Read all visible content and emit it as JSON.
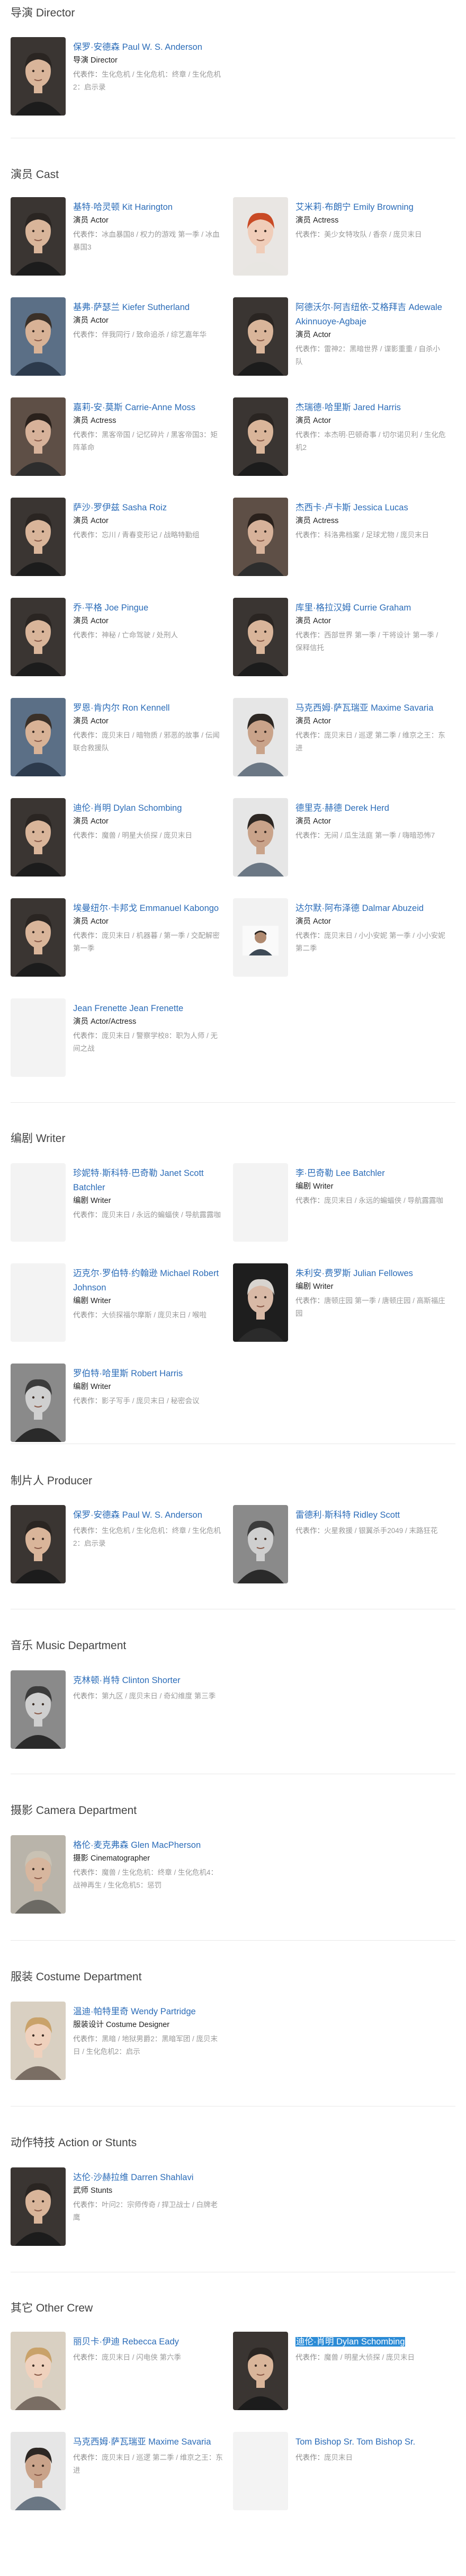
{
  "sections": {
    "director": {
      "title": "导演 Director",
      "people": [
        {
          "name": "保罗·安德森 Paul W. S. Anderson",
          "role": "导演 Director",
          "works_label": "代表作：",
          "works": "生化危机 / 生化危机：终章 / 生化危机2：启示录",
          "photo": "man-dark"
        }
      ]
    },
    "cast": {
      "title": "演员 Cast",
      "people": [
        {
          "name": "基特·哈灵顿 Kit Harington",
          "role": "演员 Actor",
          "works_label": "代表作：",
          "works": "冰血暴国8 / 权力的游戏 第一季 / 冰血暴国3",
          "photo": "man-dark"
        },
        {
          "name": "艾米莉·布朗宁 Emily Browning",
          "role": "演员 Actress",
          "works_label": "代表作：",
          "works": "美少女特攻队 / 香奈 / 庞贝末日",
          "photo": "woman-red"
        },
        {
          "name": "基弗·萨瑟兰 Kiefer Sutherland",
          "role": "演员 Actor",
          "works_label": "代表作：",
          "works": "伴我同行 / 致命追杀 / 综艺嘉年华",
          "photo": "man-blue"
        },
        {
          "name": "阿德沃尔·阿吉纽依-艾格拜吉 Adewale Akinnuoye-Agbaje",
          "role": "演员 Actor",
          "works_label": "代表作：",
          "works": "雷神2：黑暗世界 / 谍影重重 / 自杀小队",
          "photo": "man-dark"
        },
        {
          "name": "嘉莉-安·莫斯 Carrie-Anne Moss",
          "role": "演员 Actress",
          "works_label": "代表作：",
          "works": "黑客帝国 / 记忆碎片 / 黑客帝国3：矩阵革命",
          "photo": "woman-dark"
        },
        {
          "name": "杰瑞德·哈里斯 Jared Harris",
          "role": "演员 Actor",
          "works_label": "代表作：",
          "works": "本杰明·巴顿奇事 / 切尔诺贝利 / 生化危机2",
          "photo": "man-dark"
        },
        {
          "name": "萨沙·罗伊兹 Sasha Roiz",
          "role": "演员 Actor",
          "works_label": "代表作：",
          "works": "忘川 / 青春变形记 / 战略特勤组",
          "photo": "man-dark"
        },
        {
          "name": "杰西卡·卢卡斯 Jessica Lucas",
          "role": "演员 Actress",
          "works_label": "代表作：",
          "works": "科洛弗档案 / 足球尤物 / 庞贝末日",
          "photo": "woman-dark"
        },
        {
          "name": "乔·平格 Joe Pingue",
          "role": "演员 Actor",
          "works_label": "代表作：",
          "works": "神秘 / 亡命驾驶 / 处刑人",
          "photo": "man-dark"
        },
        {
          "name": "库里·格拉汉姆 Currie Graham",
          "role": "演员 Actor",
          "works_label": "代表作：",
          "works": "西部世界 第一季 / 干将设计 第一季 / 保释信托",
          "photo": "man-dark"
        },
        {
          "name": "罗恩·肯内尔 Ron Kennell",
          "role": "演员 Actor",
          "works_label": "代表作：",
          "works": "庞贝末日 / 暗物质 / 邪恶的故事 / 伝闻联合救援队",
          "photo": "man-blue"
        },
        {
          "name": "马克西姆·萨瓦瑞亚 Maxime Savaria",
          "role": "演员 Actor",
          "works_label": "代表作：",
          "works": "庞贝末日 / 巡逻 第二季 / 维京之王：东进",
          "photo": "man-light"
        },
        {
          "name": "迪伦·肖明 Dylan Schombing",
          "role": "演员 Actor",
          "works_label": "代表作：",
          "works": "魔兽 / 明星大侦探 / 庞贝末日",
          "photo": "man-dark"
        },
        {
          "name": "德里克·赫德 Derek Herd",
          "role": "演员 Actor",
          "works_label": "代表作：",
          "works": "无间 / 瓜生法庭 第一季 / 嗨暗恐怖7",
          "photo": "man-light"
        },
        {
          "name": "埃曼纽尔·卡邦戈 Emmanuel Kabongo",
          "role": "演员 Actor",
          "works_label": "代表作：",
          "works": "庞贝末日 / 机器暮 / 第一季 / 交配解密 第一季",
          "photo": "man-dark"
        },
        {
          "name": "达尔默·阿布泽德 Dalmar Abuzeid",
          "role": "演员 Actor",
          "works_label": "代表作：",
          "works": "庞贝末日 / 小小安妮 第一季 / 小小安妮 第二季",
          "photo": "man-small"
        },
        {
          "name": "Jean Frenette Jean Frenette",
          "role": "演员 Actor/Actress",
          "works_label": "代表作：",
          "works": "庞贝末日 / 警察学校8：职为人师 / 无间之战",
          "photo": "placeholder"
        }
      ]
    },
    "writer": {
      "title": "编剧 Writer",
      "people": [
        {
          "name": "珍妮特·斯科特·巴奇勒 Janet Scott Batchler",
          "role": "编剧 Writer",
          "works_label": "代表作：",
          "works": "庞贝末日 / 永远的蝙蝠侠 / 导航露露咖",
          "photo": "placeholder"
        },
        {
          "name": "李·巴奇勒 Lee Batchler",
          "role": "编剧 Writer",
          "works_label": "代表作：",
          "works": "庞贝末日 / 永远的蝙蝠侠 / 导航露露咖",
          "photo": "placeholder"
        },
        {
          "name": "迈克尔·罗伯特·约翰逊 Michael Robert Johnson",
          "role": "编剧 Writer",
          "works_label": "代表作：",
          "works": "大侦探福尔摩斯 / 庞贝末日 / 喉啦",
          "photo": "placeholder"
        },
        {
          "name": "朱利安·费罗斯 Julian Fellowes",
          "role": "编剧 Writer",
          "works_label": "代表作：",
          "works": "唐顿庄园 第一季 / 唐顿庄园 / 高斯福庄园",
          "photo": "man-old"
        },
        {
          "name": "罗伯特·哈里斯 Robert Harris",
          "role": "编剧 Writer",
          "works_label": "代表作：",
          "works": "影子写手 / 庞贝末日 / 秘密会议",
          "photo": "man-bw"
        }
      ]
    },
    "producer": {
      "title": "制片人 Producer",
      "people": [
        {
          "name": "保罗·安德森 Paul W. S. Anderson",
          "role": "",
          "works_label": "代表作：",
          "works": "生化危机 / 生化危机：终章 / 生化危机2：启示录",
          "photo": "man-dark"
        },
        {
          "name": "雷德利·斯科特 Ridley Scott",
          "role": "",
          "works_label": "代表作：",
          "works": "火星救援 / 银翼杀手2049 / 末路狂花",
          "photo": "man-bw"
        }
      ]
    },
    "music": {
      "title": "音乐 Music Department",
      "people": [
        {
          "name": "克林顿·肖特 Clinton Shorter",
          "role": "",
          "works_label": "代表作：",
          "works": "第九区 / 庞贝末日 / 奇幻维度 第三季",
          "photo": "man-bw"
        }
      ]
    },
    "camera": {
      "title": "摄影 Camera Department",
      "people": [
        {
          "name": "格伦·麦克弗森 Glen MacPherson",
          "role": "摄影 Cinematographer",
          "works_label": "代表作：",
          "works": "魔兽 / 生化危机：终章 / 生化危机4：战神再生 / 生化危机5：惩罚",
          "photo": "man-gray"
        }
      ]
    },
    "costume": {
      "title": "服装 Costume Department",
      "people": [
        {
          "name": "温迪·帕特里奇 Wendy Partridge",
          "role": "服装设计 Costume Designer",
          "works_label": "代表作：",
          "works": "黑暗 / 地狱男爵2：黑暗军团 / 庞贝末日 / 生化危机2：启示",
          "photo": "woman-blonde"
        }
      ]
    },
    "stunts": {
      "title": "动作特技 Action or Stunts",
      "people": [
        {
          "name": "达伦·沙赫拉维 Darren Shahlavi",
          "role": "武师 Stunts",
          "works_label": "代表作：",
          "works": "叶问2：宗师传奇 / 捍卫战士 / 白牌老鹰",
          "photo": "man-dark"
        }
      ]
    },
    "other": {
      "title": "其它 Other Crew",
      "people": [
        {
          "name": "丽贝卡·伊迪 Rebecca Eady",
          "role": "",
          "works_label": "代表作：",
          "works": "庞贝末日 / 闪电侠 第六季",
          "photo": "woman-blonde"
        },
        {
          "name": "迪伦·肖明 Dylan Schombing",
          "highlight": true,
          "role": "",
          "works_label": "代表作：",
          "works": "魔兽 / 明星大侦探 / 庞贝末日",
          "photo": "man-dark"
        },
        {
          "name": "马克西姆·萨瓦瑞亚 Maxime Savaria",
          "role": "",
          "works_label": "代表作：",
          "works": "庞贝末日 / 巡逻 第二季 / 维京之王：东进",
          "photo": "man-light"
        },
        {
          "name": "Tom Bishop Sr. Tom Bishop Sr.",
          "role": "",
          "works_label": "代表作：",
          "works": "庞贝末日",
          "photo": "placeholder"
        }
      ]
    }
  }
}
